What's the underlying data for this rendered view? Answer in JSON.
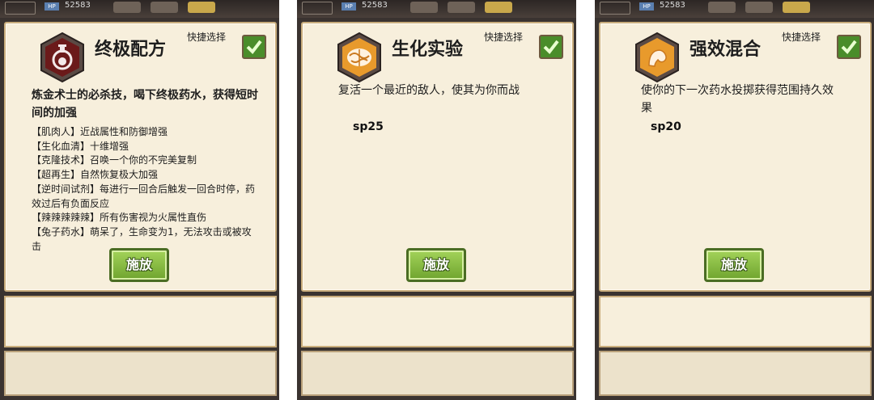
{
  "top_bar": {
    "hp_label": "HP",
    "hp_value": "52583"
  },
  "quick_select_label": "快捷选择",
  "cast_label": "施放",
  "cards": [
    {
      "title": "终极配方",
      "icon": "potion-flask-icon",
      "description": "炼金术士的必杀技，喝下终极药水，获得短时间的加强",
      "options": [
        "【肌肉人】近战属性和防御增强",
        "【生化血清】十维增强",
        "【克隆技术】召唤一个你的不完美复制",
        "【超再生】自然恢复极大加强",
        "【逆时间试剂】每进行一回合后触发一回合时停，药效过后有负面反应",
        "【辣辣辣辣辣】所有伤害视为火属性直伤",
        "【兔子药水】萌呆了，生命变为1，无法攻击或被攻击"
      ]
    },
    {
      "title": "生化实验",
      "icon": "brain-icon",
      "description": "复活一个最近的敌人，使其为你而战",
      "sp": "sp25"
    },
    {
      "title": "强效混合",
      "icon": "flexed-arm-icon",
      "description": "使你的下一次药水投掷获得范围持久效果",
      "sp": "sp20"
    }
  ],
  "colors": {
    "card_bg": "#f7efdc",
    "card_border": "#c9ad7c",
    "cast_button": "#8cc043",
    "check_green": "#4a8d2a",
    "icon_dark_red": "#6b1a1a",
    "icon_orange": "#e89a2c"
  }
}
